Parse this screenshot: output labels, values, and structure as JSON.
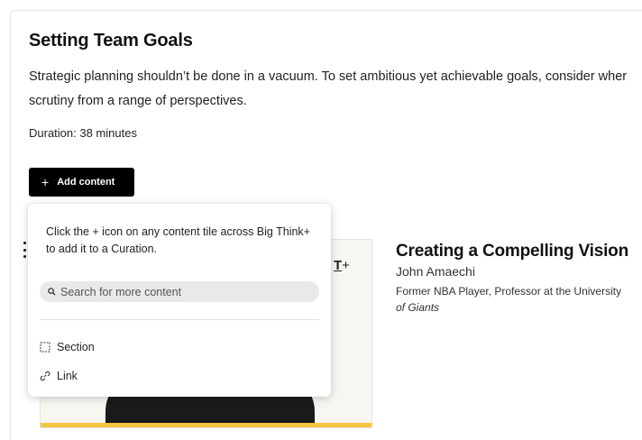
{
  "module": {
    "title": "Setting Team Goals",
    "description_line1": "Strategic planning shouldn’t be done in a vacuum. To set ambitious yet achievable goals, consider wher",
    "description_line2": "scrutiny from a range of perspectives.",
    "duration": "Duration: 38 minutes",
    "add_content_label": "Add content",
    "add_content_icon": "+"
  },
  "dropdown": {
    "hint": "Click the + icon on any content tile across Big Think+ to add it to a Curation.",
    "search_placeholder": "Search for more content",
    "menu": [
      {
        "label": "Section",
        "icon": "section-icon"
      },
      {
        "label": "Link",
        "icon": "link-icon"
      }
    ]
  },
  "content_item": {
    "title": "Creating a Compelling Vision",
    "author": "John Amaechi",
    "role": "Former NBA Player, Professor at the University",
    "book": "of Giants",
    "tile_add_text": "T",
    "tile_add_icon": "+",
    "accent_color": "#f4c542"
  }
}
